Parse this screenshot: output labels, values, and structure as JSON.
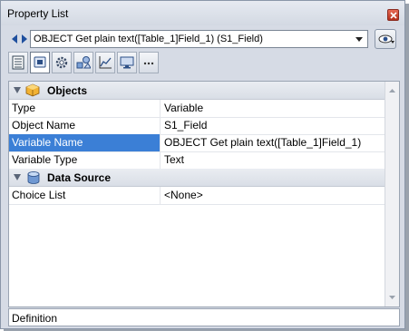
{
  "window": {
    "title": "Property List"
  },
  "object_selector": {
    "value": "OBJECT Get plain text([Table_1]Field_1) (S1_Field)"
  },
  "toolbar": {
    "tools": [
      {
        "icon": "list-icon"
      },
      {
        "icon": "object-icon",
        "active": true
      },
      {
        "icon": "gear-icon"
      },
      {
        "icon": "shapes-icon"
      },
      {
        "icon": "chart-icon"
      },
      {
        "icon": "monitor-icon"
      },
      {
        "icon": "more-icon"
      }
    ]
  },
  "sections": {
    "objects": {
      "label": "Objects",
      "rows": [
        {
          "name": "Type",
          "value": "Variable"
        },
        {
          "name": "Object Name",
          "value": "S1_Field"
        },
        {
          "name": "Variable Name",
          "value": "OBJECT Get plain text([Table_1]Field_1)",
          "selected": true
        },
        {
          "name": "Variable Type",
          "value": "Text"
        }
      ]
    },
    "data_source": {
      "label": "Data Source",
      "rows": [
        {
          "name": "Choice List",
          "value": "<None>"
        }
      ]
    }
  },
  "footer": {
    "label": "Definition"
  }
}
